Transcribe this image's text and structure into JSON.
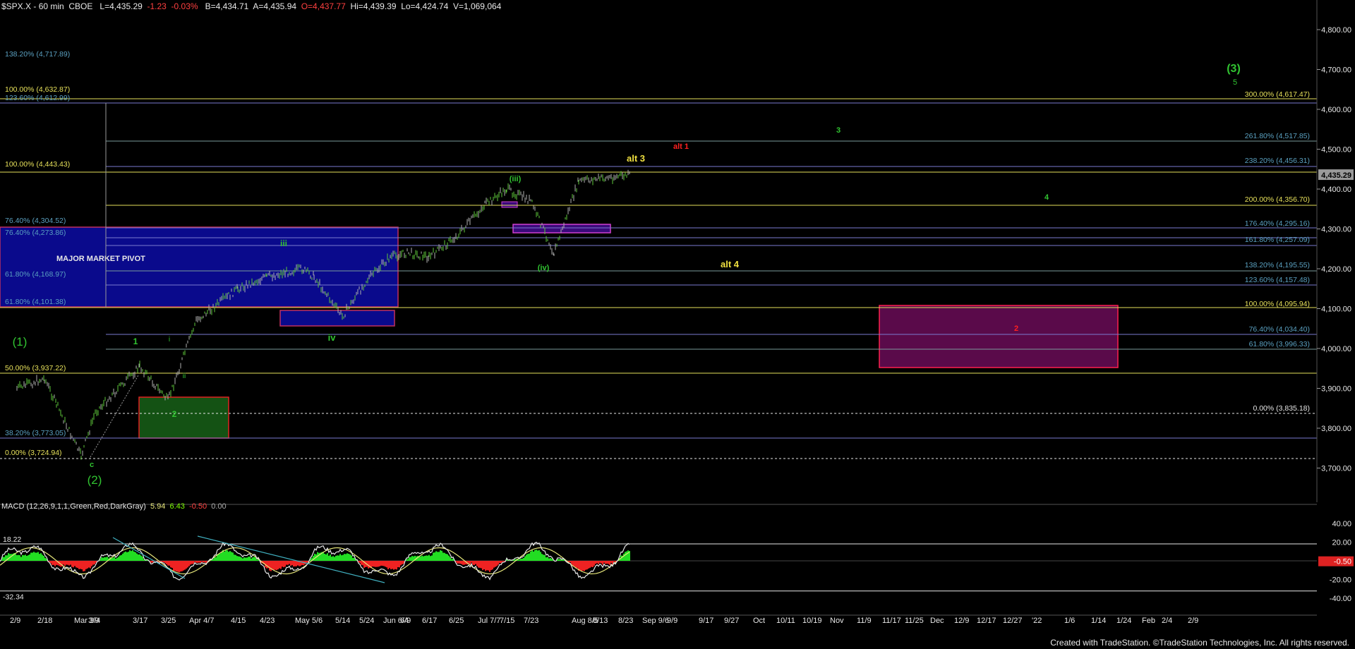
{
  "header": {
    "symbol": "$SPX.X - 60 min  CBOE",
    "last": "L=4,435.29",
    "change": "-1.23",
    "pct": "-0.03%",
    "bid": "B=4,434.71",
    "ask": "A=4,435.94",
    "open": "O=4,437.77",
    "hi": "Hi=4,439.39",
    "lo": "Lo=4,424.74",
    "vol": "V=1,069,064"
  },
  "macd_header": {
    "label": "MACD (12,26,9,1,1,Green,Red,DarkGray)",
    "v1": "5.94",
    "v2": "6.43",
    "v3": "-0.50",
    "v4": "0.00"
  },
  "footer": "Created with TradeStation. ©TradeStation Technologies, Inc. All rights reserved.",
  "colors": {
    "background": "#000000",
    "grid_line": "#4a4a8a",
    "yellow_line": "#e6e05a",
    "blue_box": "#0a0a8c",
    "purple_box": "#5a0a4a",
    "green_box": "#145214",
    "up_bar": "#5ec83a",
    "down_bar": "#b0b0b0",
    "wave_green": "#31c431",
    "wave_yellow": "#f0e040",
    "wave_red": "#ff2020",
    "fib_text": "#5aa0c0",
    "macd_pos": "#22dd22",
    "macd_neg": "#ee2222",
    "last_price_box": "#9a9a9a",
    "macd_last_box": "#dd2222"
  },
  "price_axis": [
    "4,800.00",
    "4,700.00",
    "4,600.00",
    "4,500.00",
    "4,400.00",
    "4,300.00",
    "4,200.00",
    "4,100.00",
    "4,000.00",
    "3,900.00",
    "3,800.00",
    "3,700.00"
  ],
  "last_price_label": "4,435.29",
  "macd_axis": [
    "40.00",
    "20.00",
    "0.00",
    "-20.00",
    "-40.00"
  ],
  "macd_last_label": "-0.50",
  "macd_levels": [
    "18.22",
    "-32.34"
  ],
  "date_axis": [
    "2/9",
    "2/18",
    "Mar 3/4",
    "3/9",
    "3/17",
    "3/25",
    "Apr 4/7",
    "4/15",
    "4/23",
    "May 5/6",
    "5/14",
    "5/24",
    "Jun 6/4",
    "6/9",
    "6/17",
    "6/25",
    "Jul 7/7",
    "7/15",
    "7/23",
    "Aug 8/5",
    "8/13",
    "8/23",
    "Sep 9/6",
    "9/9",
    "9/17",
    "9/27",
    "Oct",
    "10/11",
    "10/19",
    "Nov",
    "11/9",
    "11/17",
    "11/25",
    "Dec",
    "12/9",
    "12/17",
    "12/27",
    "'22",
    "1/6",
    "1/14",
    "1/24",
    "Feb",
    "2/4",
    "2/9"
  ],
  "left_fibs": [
    {
      "label": "138.20% (4,717.89)",
      "color": "#5aa0c0"
    },
    {
      "label": "100.00% (4,632.87)",
      "color": "#e6e05a"
    },
    {
      "label": "123.60% (4,612.99)",
      "color": "#5aa0c0"
    },
    {
      "label": "100.00% (4,443.43)",
      "color": "#e6e05a"
    },
    {
      "label": "76.40% (4,304.52)",
      "color": "#5aa0c0"
    },
    {
      "label": "76.40% (4,273.86)",
      "color": "#5aa0c0"
    },
    {
      "label": "61.80% (4,168.97)",
      "color": "#5aa0c0"
    },
    {
      "label": "61.80% (4,101.38)",
      "color": "#5aa0c0"
    },
    {
      "label": "50.00% (3,937.22)",
      "color": "#e6e05a"
    },
    {
      "label": "38.20% (3,773.05)",
      "color": "#5aa0c0"
    },
    {
      "label": "0.00% (3,724.94)",
      "color": "#e6e05a"
    }
  ],
  "right_fibs": [
    {
      "label": "300.00% (4,617.47)",
      "color": "#e6e05a"
    },
    {
      "label": "261.80% (4,517.85)",
      "color": "#5aa0c0"
    },
    {
      "label": "238.20% (4,456.31)",
      "color": "#5aa0c0"
    },
    {
      "label": "200.00% (4,356.70)",
      "color": "#e6e05a"
    },
    {
      "label": "176.40% (4,295.16)",
      "color": "#5aa0c0"
    },
    {
      "label": "161.80% (4,257.09)",
      "color": "#5aa0c0"
    },
    {
      "label": "138.20% (4,195.55)",
      "color": "#5aa0c0"
    },
    {
      "label": "123.60% (4,157.48)",
      "color": "#5aa0c0"
    },
    {
      "label": "100.00% (4,095.94)",
      "color": "#e6e05a"
    },
    {
      "label": "76.40% (4,034.40)",
      "color": "#5aa0c0"
    },
    {
      "label": "61.80% (3,996.33)",
      "color": "#5aa0c0"
    },
    {
      "label": "0.00% (3,835.18)",
      "color": "#e6e6e6"
    }
  ],
  "box_label": "MAJOR MARKET PIVOT",
  "wave_labels": [
    {
      "text": "(3)",
      "color": "#31c431"
    },
    {
      "text": "5",
      "color": "#31c431"
    },
    {
      "text": "3",
      "color": "#31c431"
    },
    {
      "text": "alt 1",
      "color": "#ff2020"
    },
    {
      "text": "alt 3",
      "color": "#f0e040"
    },
    {
      "text": "(iii)",
      "color": "#31c431"
    },
    {
      "text": "4",
      "color": "#31c431"
    },
    {
      "text": "iii",
      "color": "#31c431"
    },
    {
      "text": "(iv)",
      "color": "#31c431"
    },
    {
      "text": "alt 4",
      "color": "#f0e040"
    },
    {
      "text": "2",
      "color": "#ff2020"
    },
    {
      "text": "iv",
      "color": "#31c431"
    },
    {
      "text": "(1)",
      "color": "#31c431"
    },
    {
      "text": "1",
      "color": "#31c431"
    },
    {
      "text": "i",
      "color": "#31c431"
    },
    {
      "text": "ii",
      "color": "#31c431"
    },
    {
      "text": "2",
      "color": "#31c431"
    },
    {
      "text": "c",
      "color": "#31c431"
    },
    {
      "text": "(2)",
      "color": "#31c431"
    }
  ],
  "chart_data": {
    "type": "line",
    "title": "$SPX.X - 60 min",
    "ylim": [
      3650,
      4860
    ],
    "y_ticks": [
      3700,
      3800,
      3900,
      4000,
      4100,
      4200,
      4300,
      4400,
      4500,
      4600,
      4700,
      4800
    ],
    "price_path": {
      "x": [
        "2/9",
        "2/18",
        "2/25",
        "Mar 3/4",
        "3/9",
        "3/17",
        "3/25",
        "Apr 4/7",
        "4/15",
        "4/23",
        "May 5/6",
        "5/10",
        "5/14",
        "5/24",
        "Jun 6/4",
        "6/9",
        "6/17",
        "6/25",
        "Jul 7/7",
        "7/15",
        "7/19",
        "7/23",
        "Aug 8/5",
        "8/10"
      ],
      "y": [
        3900,
        3925,
        3860,
        3730,
        3840,
        3955,
        3870,
        4070,
        4150,
        4180,
        4200,
        4180,
        4080,
        4170,
        4230,
        4240,
        4230,
        4280,
        4360,
        4400,
        4240,
        4370,
        4420,
        4435
      ]
    },
    "last_price": 4435.29,
    "macd": {
      "ylim": [
        -45,
        45
      ],
      "last": -0.5,
      "levels": [
        18.22,
        -32.34
      ]
    }
  }
}
